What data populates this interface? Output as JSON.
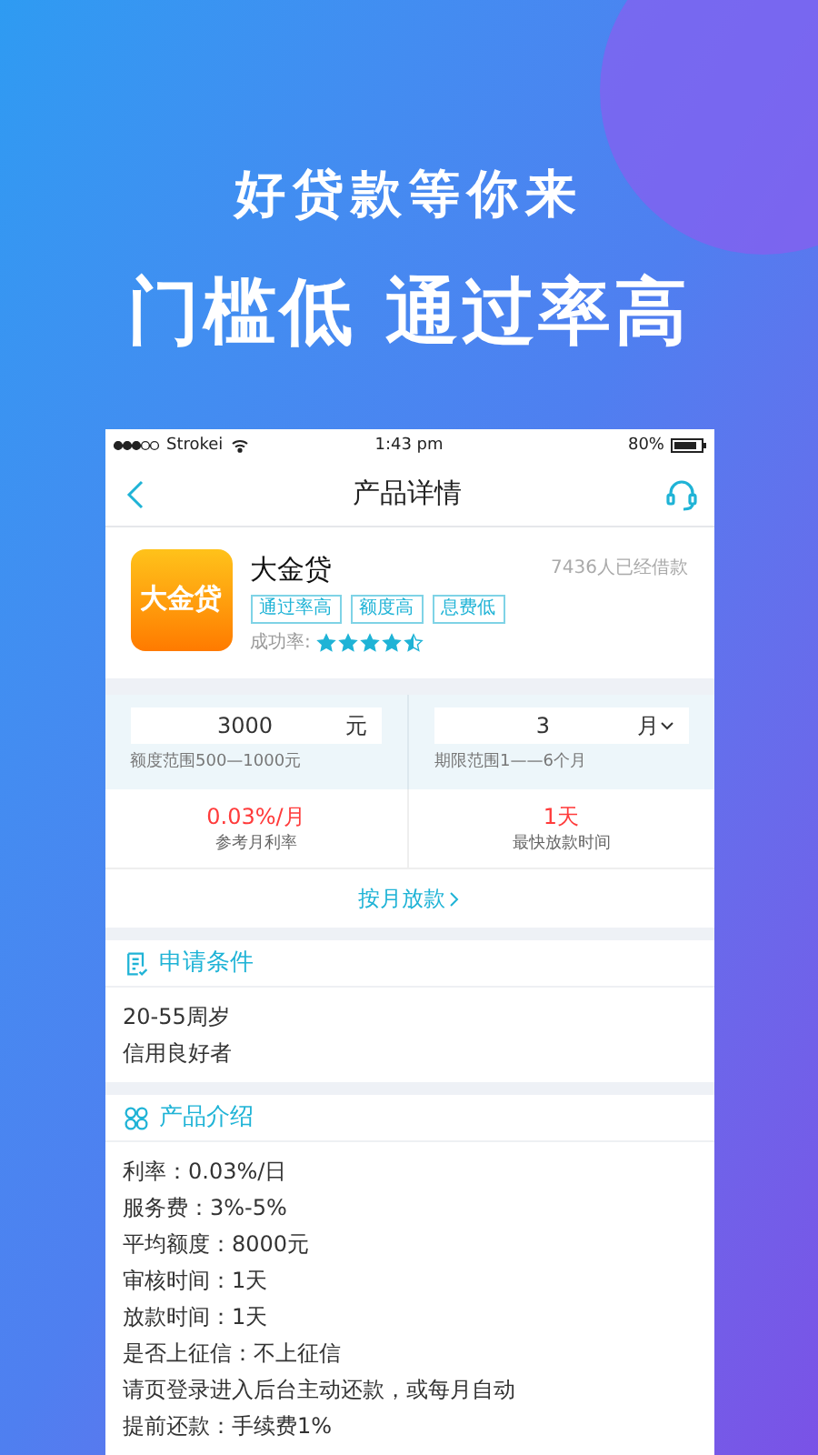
{
  "promo": {
    "headline": "好贷款等你来",
    "subheadline": "门槛低 通过率高"
  },
  "status_bar": {
    "carrier": "Strokei",
    "time": "1:43 pm",
    "battery": "80%"
  },
  "nav": {
    "title": "产品详情"
  },
  "product": {
    "logo_text": "大金贷",
    "name": "大金贷",
    "borrowers": "7436人已经借款",
    "tags": [
      "通过率高",
      "额度高",
      "息费低"
    ],
    "rate_label": "成功率:",
    "stars": 4.5
  },
  "loan": {
    "amount": {
      "value": "3000",
      "unit": "元",
      "hint": "额度范围500—1000元"
    },
    "term": {
      "value": "3",
      "unit": "月",
      "hint": "期限范围1——6个月"
    }
  },
  "stats": [
    {
      "value": "0.03%/月",
      "label": "参考月利率"
    },
    {
      "value": "1天",
      "label": "最快放款时间"
    }
  ],
  "repay_link": "按月放款",
  "sections": [
    {
      "kind": "conditions",
      "title": "申请条件",
      "lines": [
        "20-55周岁",
        "信用良好者"
      ]
    },
    {
      "kind": "intro",
      "title": "产品介绍",
      "lines": [
        "利率：0.03%/日",
        "服务费：3%-5%",
        "平均额度：8000元",
        "审核时间：1天",
        "放款时间：1天",
        "是否上征信：不上征信",
        "请页登录进入后台主动还款，或每月自动",
        "提前还款：手续费1%"
      ]
    }
  ]
}
